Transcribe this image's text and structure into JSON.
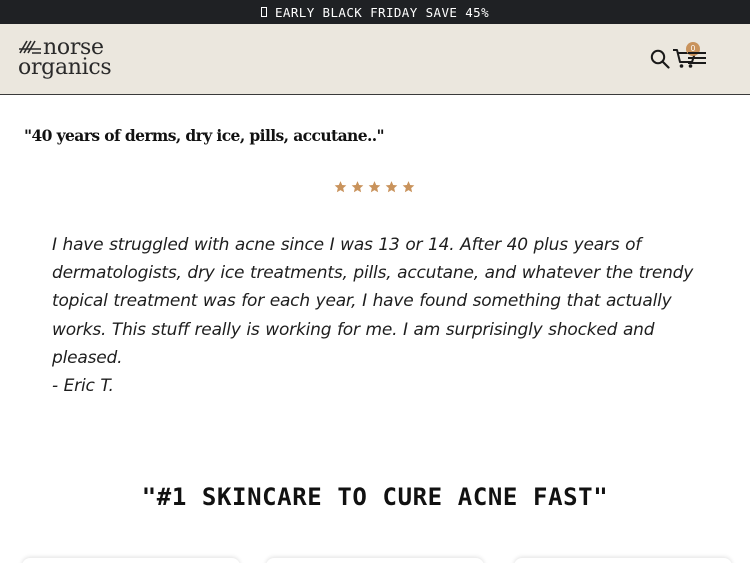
{
  "announcement": {
    "text": "EARLY BLACK FRIDAY SAVE 45%"
  },
  "header": {
    "logo": {
      "line1": "norse",
      "line2": "organics"
    },
    "cart": {
      "count": "0"
    },
    "icons": [
      "search-icon",
      "cart-icon",
      "hamburger-menu-icon"
    ]
  },
  "review": {
    "title": "\"40 years of derms, dry ice, pills, accutane..\"",
    "rating": 5,
    "body": "I have struggled with acne since I was 13 or 14. After 40 plus years of dermatologists, dry ice treatments, pills, accutane, and whatever the trendy topical treatment was for each year, I have found something that actually works. This stuff really is working for me. I am surprisingly shocked and pleased.",
    "author": "- Eric T."
  },
  "section": {
    "headline": "\"#1 SKINCARE TO CURE ACNE FAST\""
  },
  "colors": {
    "announce_bg": "#1f2124",
    "header_bg": "#ebe7de",
    "accent": "#c9935c"
  }
}
